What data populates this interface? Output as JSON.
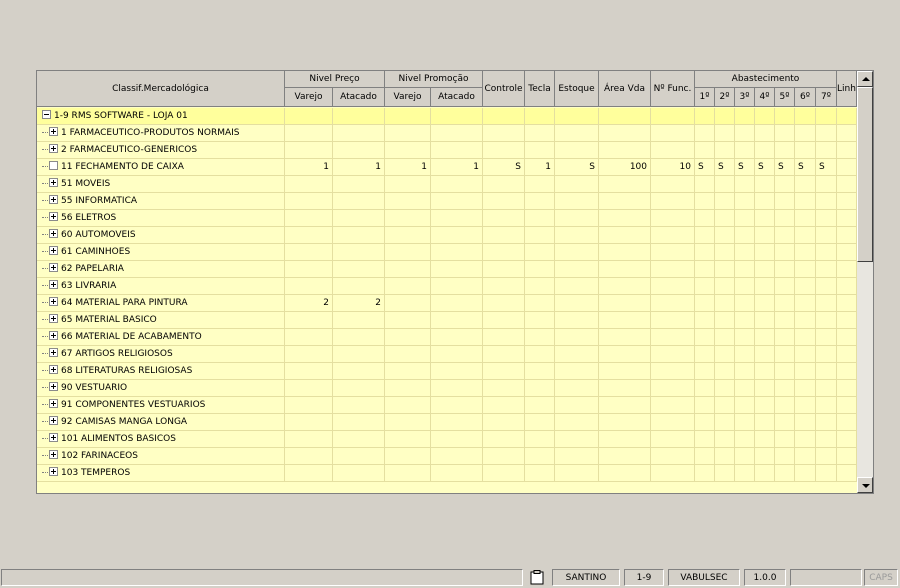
{
  "columns": {
    "classif": "Classif.Mercadológica",
    "nivel_preco": "Nivel Preço",
    "nivel_promocao": "Nivel Promoção",
    "varejo": "Varejo",
    "atacado": "Atacado",
    "controle": "Controle",
    "tecla": "Tecla",
    "estoque": "Estoque",
    "area_vda": "Área Vda",
    "n_func": "Nº Func.",
    "abastecimento": "Abastecimento",
    "abast_days": [
      "1º",
      "2º",
      "3º",
      "4º",
      "5º",
      "6º",
      "7º"
    ],
    "linha": "Linha"
  },
  "rows": [
    {
      "name": "1-9 RMS SOFTWARE - LOJA 01",
      "node": "root",
      "cells": [
        "",
        "",
        "",
        "",
        "",
        "",
        "",
        "",
        "",
        "",
        "",
        "",
        "",
        "",
        "",
        "",
        ""
      ]
    },
    {
      "name": "1 FARMACEUTICO-PRODUTOS NORMAIS",
      "node": "plus",
      "cells": [
        "",
        "",
        "",
        "",
        "",
        "",
        "",
        "",
        "",
        "",
        "",
        "",
        "",
        "",
        "",
        "",
        ""
      ]
    },
    {
      "name": "2 FARMACEUTICO-GENERICOS",
      "node": "plus",
      "cells": [
        "",
        "",
        "",
        "",
        "",
        "",
        "",
        "",
        "",
        "",
        "",
        "",
        "",
        "",
        "",
        "",
        ""
      ]
    },
    {
      "name": "11 FECHAMENTO DE CAIXA",
      "node": "leaf",
      "cells": [
        "1",
        "1",
        "1",
        "1",
        "S",
        "1",
        "S",
        "100",
        "10",
        "S",
        "S",
        "S",
        "S",
        "S",
        "S",
        "S",
        ""
      ]
    },
    {
      "name": "51 MOVEIS",
      "node": "plus",
      "cells": [
        "",
        "",
        "",
        "",
        "",
        "",
        "",
        "",
        "",
        "",
        "",
        "",
        "",
        "",
        "",
        "",
        ""
      ]
    },
    {
      "name": "55 INFORMATICA",
      "node": "plus",
      "cells": [
        "",
        "",
        "",
        "",
        "",
        "",
        "",
        "",
        "",
        "",
        "",
        "",
        "",
        "",
        "",
        "",
        ""
      ]
    },
    {
      "name": "56 ELETROS",
      "node": "plus",
      "cells": [
        "",
        "",
        "",
        "",
        "",
        "",
        "",
        "",
        "",
        "",
        "",
        "",
        "",
        "",
        "",
        "",
        ""
      ]
    },
    {
      "name": "60 AUTOMOVEIS",
      "node": "plus",
      "cells": [
        "",
        "",
        "",
        "",
        "",
        "",
        "",
        "",
        "",
        "",
        "",
        "",
        "",
        "",
        "",
        "",
        ""
      ]
    },
    {
      "name": "61 CAMINHOES",
      "node": "plus",
      "cells": [
        "",
        "",
        "",
        "",
        "",
        "",
        "",
        "",
        "",
        "",
        "",
        "",
        "",
        "",
        "",
        "",
        ""
      ]
    },
    {
      "name": "62 PAPELARIA",
      "node": "plus",
      "cells": [
        "",
        "",
        "",
        "",
        "",
        "",
        "",
        "",
        "",
        "",
        "",
        "",
        "",
        "",
        "",
        "",
        ""
      ]
    },
    {
      "name": "63 LIVRARIA",
      "node": "plus",
      "cells": [
        "",
        "",
        "",
        "",
        "",
        "",
        "",
        "",
        "",
        "",
        "",
        "",
        "",
        "",
        "",
        "",
        ""
      ]
    },
    {
      "name": "64 MATERIAL PARA PINTURA",
      "node": "plus",
      "cells": [
        "2",
        "2",
        "",
        "",
        "",
        "",
        "",
        "",
        "",
        "",
        "",
        "",
        "",
        "",
        "",
        "",
        ""
      ]
    },
    {
      "name": "65 MATERIAL BASICO",
      "node": "plus",
      "cells": [
        "",
        "",
        "",
        "",
        "",
        "",
        "",
        "",
        "",
        "",
        "",
        "",
        "",
        "",
        "",
        "",
        ""
      ]
    },
    {
      "name": "66 MATERIAL DE ACABAMENTO",
      "node": "plus",
      "cells": [
        "",
        "",
        "",
        "",
        "",
        "",
        "",
        "",
        "",
        "",
        "",
        "",
        "",
        "",
        "",
        "",
        ""
      ]
    },
    {
      "name": "67 ARTIGOS RELIGIOSOS",
      "node": "plus",
      "cells": [
        "",
        "",
        "",
        "",
        "",
        "",
        "",
        "",
        "",
        "",
        "",
        "",
        "",
        "",
        "",
        "",
        ""
      ]
    },
    {
      "name": "68 LITERATURAS RELIGIOSAS",
      "node": "plus",
      "cells": [
        "",
        "",
        "",
        "",
        "",
        "",
        "",
        "",
        "",
        "",
        "",
        "",
        "",
        "",
        "",
        "",
        ""
      ]
    },
    {
      "name": "90 VESTUARIO",
      "node": "plus",
      "cells": [
        "",
        "",
        "",
        "",
        "",
        "",
        "",
        "",
        "",
        "",
        "",
        "",
        "",
        "",
        "",
        "",
        ""
      ]
    },
    {
      "name": "91 COMPONENTES VESTUARIOS",
      "node": "plus",
      "cells": [
        "",
        "",
        "",
        "",
        "",
        "",
        "",
        "",
        "",
        "",
        "",
        "",
        "",
        "",
        "",
        "",
        ""
      ]
    },
    {
      "name": "92 CAMISAS MANGA LONGA",
      "node": "plus",
      "cells": [
        "",
        "",
        "",
        "",
        "",
        "",
        "",
        "",
        "",
        "",
        "",
        "",
        "",
        "",
        "",
        "",
        ""
      ]
    },
    {
      "name": "101 ALIMENTOS BASICOS",
      "node": "plus",
      "cells": [
        "",
        "",
        "",
        "",
        "",
        "",
        "",
        "",
        "",
        "",
        "",
        "",
        "",
        "",
        "",
        "",
        ""
      ]
    },
    {
      "name": "102 FARINACEOS",
      "node": "plus",
      "cells": [
        "",
        "",
        "",
        "",
        "",
        "",
        "",
        "",
        "",
        "",
        "",
        "",
        "",
        "",
        "",
        "",
        ""
      ]
    },
    {
      "name": "103 TEMPEROS",
      "node": "plus",
      "cells": [
        "",
        "",
        "",
        "",
        "",
        "",
        "",
        "",
        "",
        "",
        "",
        "",
        "",
        "",
        "",
        "",
        ""
      ]
    }
  ],
  "selected_row": 0,
  "status": {
    "clipboard_icon": "clipboard-icon",
    "user": "SANTINO",
    "store": "1-9",
    "db": "VABULSEC",
    "version": "1.0.0",
    "caps": "CAPS"
  },
  "colors": {
    "row_bg": "#ffffc4",
    "selected_row_bg": "#ffff9c",
    "header_bg": "#d4d0c8"
  }
}
